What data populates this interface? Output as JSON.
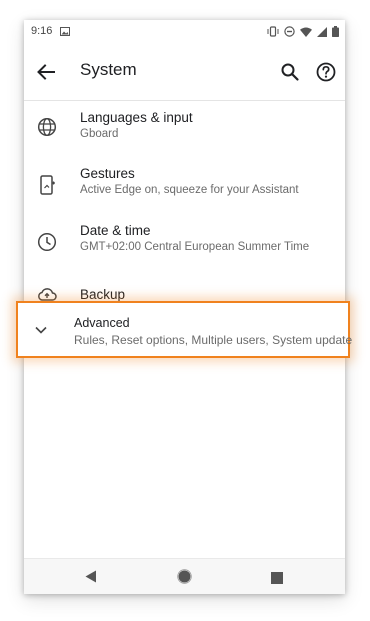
{
  "status_bar": {
    "time": "9:16",
    "icons": [
      "image-icon",
      "vibrate-icon",
      "dnd-icon",
      "wifi-icon",
      "signal-icon",
      "battery-icon"
    ]
  },
  "app_bar": {
    "title": "System",
    "icons": [
      "back-arrow-icon",
      "search-icon",
      "help-icon"
    ]
  },
  "settings": {
    "items": [
      {
        "title": "Languages & input",
        "subtitle": "Gboard",
        "icon": "globe-icon"
      },
      {
        "title": "Gestures",
        "subtitle": "Active Edge on, squeeze for your Assistant",
        "icon": "phone-gesture-icon"
      },
      {
        "title": "Date & time",
        "subtitle": "GMT+02:00 Central European Summer Time",
        "icon": "clock-icon"
      },
      {
        "title": "Backup",
        "subtitle": "",
        "icon": "cloud-upload-icon"
      }
    ],
    "advanced": {
      "title": "Advanced",
      "subtitle": "Rules, Reset options, Multiple users, System update",
      "icon": "chevron-down-icon"
    }
  },
  "nav_bar": {
    "icons": [
      "nav-back-icon",
      "nav-home-icon",
      "nav-recents-icon"
    ]
  },
  "colors": {
    "highlight": "#f0821e",
    "text_primary": "#202124",
    "text_secondary": "#6b6b6b"
  }
}
